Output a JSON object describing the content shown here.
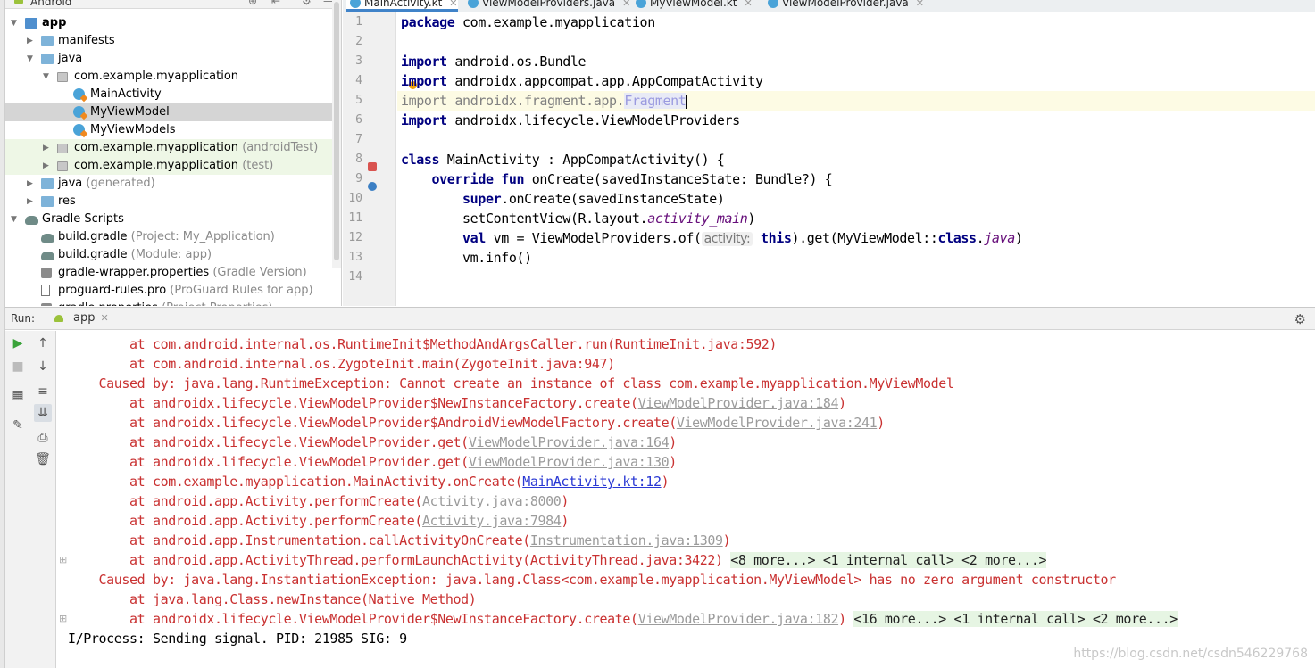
{
  "project_panel": {
    "header_label": "Android",
    "tree": [
      {
        "name": "app",
        "sub": "",
        "kind": "folder-blue",
        "arrow": "▼",
        "bold": true
      },
      {
        "name": "manifests",
        "sub": "",
        "kind": "folder",
        "arrow": "▶"
      },
      {
        "name": "java",
        "sub": "",
        "kind": "folder",
        "arrow": "▼"
      },
      {
        "name": "com.example.myapplication",
        "sub": "",
        "kind": "pkg",
        "arrow": "▼"
      },
      {
        "name": "MainActivity",
        "sub": "",
        "kind": "kt",
        "arrow": ""
      },
      {
        "name": "MyViewModel",
        "sub": "",
        "kind": "kt",
        "arrow": "",
        "selected": true
      },
      {
        "name": "MyViewModels",
        "sub": "",
        "kind": "kt",
        "arrow": ""
      },
      {
        "name": "com.example.myapplication",
        "sub": "(androidTest)",
        "kind": "pkg",
        "arrow": "▶",
        "test": true
      },
      {
        "name": "com.example.myapplication",
        "sub": "(test)",
        "kind": "pkg",
        "arrow": "▶",
        "test": true
      },
      {
        "name": "java",
        "sub": "(generated)",
        "kind": "folder",
        "arrow": "▶"
      },
      {
        "name": "res",
        "sub": "",
        "kind": "folder",
        "arrow": "▶"
      },
      {
        "name": "Gradle Scripts",
        "sub": "",
        "kind": "gradle",
        "arrow": "▼"
      },
      {
        "name": "build.gradle",
        "sub": "(Project: My_Application)",
        "kind": "gradle",
        "arrow": ""
      },
      {
        "name": "build.gradle",
        "sub": "(Module: app)",
        "kind": "gradle",
        "arrow": ""
      },
      {
        "name": "gradle-wrapper.properties",
        "sub": "(Gradle Version)",
        "kind": "gear",
        "arrow": ""
      },
      {
        "name": "proguard-rules.pro",
        "sub": "(ProGuard Rules for app)",
        "kind": "file",
        "arrow": ""
      },
      {
        "name": "gradle.properties",
        "sub": "(Project Properties)",
        "kind": "gear",
        "arrow": ""
      }
    ]
  },
  "editor": {
    "tabs": [
      {
        "label": "MainActivity.kt",
        "active": true
      },
      {
        "label": "ViewModelProviders.java",
        "active": false
      },
      {
        "label": "MyViewModel.kt",
        "active": false
      },
      {
        "label": "ViewModelProvider.java",
        "active": false
      }
    ],
    "line_numbers": [
      "1",
      "2",
      "3",
      "4",
      "5",
      "6",
      "7",
      "8",
      "9",
      "10",
      "11",
      "12",
      "13",
      "14"
    ],
    "caret_line": 5,
    "code": {
      "l1_kw": "package",
      "l1_rest": " com.example.myapplication",
      "l3_kw": "import",
      "l3_rest": " android.os.Bundle",
      "l4_kw": "import",
      "l4_rest": " androidx.appcompat.app.AppCompatActivity",
      "l5_kw": "import",
      "l5_rest": " androidx.fragment.app.",
      "l5_frag": "Fragment",
      "l6_kw": "import",
      "l6_rest": " androidx.lifecycle.ViewModelProviders",
      "l8_kw": "class",
      "l8_rest": " MainActivity : AppCompatActivity() {",
      "l9_indent": "    ",
      "l9_kw1": "override",
      "l9_sp": " ",
      "l9_kw2": "fun",
      "l9_rest": " onCreate(savedInstanceState: Bundle?) {",
      "l10_indent": "        ",
      "l10_kw": "super",
      "l10_rest": ".onCreate(savedInstanceState)",
      "l11_indent": "        ",
      "l11_a": "setContentView(R.layout.",
      "l11_ital": "activity_main",
      "l11_b": ")",
      "l12_indent": "        ",
      "l12_kw": "val",
      "l12_a": " vm = ViewModelProviders.of(",
      "l12_hint": "activity:",
      "l12_kw2": "this",
      "l12_b": ").get(MyViewModel::",
      "l12_kw3": "class",
      "l12_c": ".",
      "l12_ital": "java",
      "l12_d": ")",
      "l13_indent": "        ",
      "l13_a": "vm.info()"
    }
  },
  "run_panel": {
    "label": "Run:",
    "tab": "app",
    "console": [
      {
        "text": "        at com.android.internal.os.RuntimeInit$MethodAndArgsCaller.run(RuntimeInit.java:592)"
      },
      {
        "text": "        at com.android.internal.os.ZygoteInit.main(ZygoteInit.java:947)"
      },
      {
        "text": "    Caused by: java.lang.RuntimeException: Cannot create an instance of class com.example.myapplication.MyViewModel"
      },
      {
        "pre": "        at androidx.lifecycle.ViewModelProvider$NewInstanceFactory.create(",
        "link": "ViewModelProvider.java:184",
        "post": ")"
      },
      {
        "pre": "        at androidx.lifecycle.ViewModelProvider$AndroidViewModelFactory.create(",
        "link": "ViewModelProvider.java:241",
        "post": ")"
      },
      {
        "pre": "        at androidx.lifecycle.ViewModelProvider.get(",
        "link": "ViewModelProvider.java:164",
        "post": ")"
      },
      {
        "pre": "        at androidx.lifecycle.ViewModelProvider.get(",
        "link": "ViewModelProvider.java:130",
        "post": ")"
      },
      {
        "pre": "        at com.example.myapplication.MainActivity.onCreate(",
        "link": "MainActivity.kt:12",
        "post": ")"
      },
      {
        "pre": "        at android.app.Activity.performCreate(",
        "link": "Activity.java:8000",
        "post": ")"
      },
      {
        "pre": "        at android.app.Activity.performCreate(",
        "link": "Activity.java:7984",
        "post": ")"
      },
      {
        "pre": "        at android.app.Instrumentation.callActivityOnCreate(",
        "link": "Instrumentation.java:1309",
        "post": ")"
      },
      {
        "pre": "        at android.app.ActivityThread.performLaunchActivity(ActivityThread.java:3422) ",
        "fold": "<8 more...> <1 internal call> <2 more...>"
      },
      {
        "text": "    Caused by: java.lang.InstantiationException: java.lang.Class<com.example.myapplication.MyViewModel> has no zero argument constructor"
      },
      {
        "text": "        at java.lang.Class.newInstance(Native Method)"
      },
      {
        "pre": "        at androidx.lifecycle.ViewModelProvider$NewInstanceFactory.create(",
        "link": "ViewModelProvider.java:182",
        "post": ") ",
        "fold": "<16 more...> <1 internal call> <2 more...>"
      },
      {
        "text": "I/Process: Sending signal. PID: 21985 SIG: 9"
      }
    ],
    "watermark": "https://blog.csdn.net/csdn546229768"
  }
}
